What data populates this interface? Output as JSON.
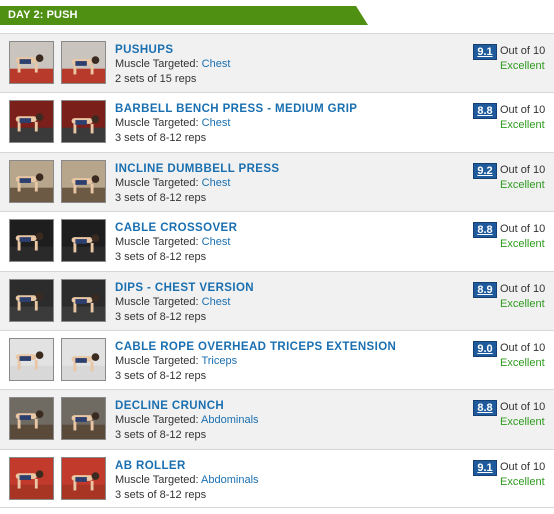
{
  "header": {
    "title": "DAY 2: PUSH",
    "color": "#4f8f12"
  },
  "labels": {
    "muscle_prefix": "Muscle Targeted:",
    "out_of": "Out of 10"
  },
  "exercises": [
    {
      "name": "PUSHUPS",
      "muscle": "Chest",
      "sets": "2 sets of 15 reps",
      "score": "9.1",
      "verdict": "Excellent",
      "thumbs": [
        "pushup-start-image",
        "pushup-end-image"
      ]
    },
    {
      "name": "BARBELL BENCH PRESS - MEDIUM GRIP",
      "muscle": "Chest",
      "sets": "3 sets of 8-12 reps",
      "score": "8.8",
      "verdict": "Excellent",
      "thumbs": [
        "bench-press-start-image",
        "bench-press-end-image"
      ]
    },
    {
      "name": "INCLINE DUMBBELL PRESS",
      "muscle": "Chest",
      "sets": "3 sets of 8-12 reps",
      "score": "9.2",
      "verdict": "Excellent",
      "thumbs": [
        "incline-press-start-image",
        "incline-press-end-image"
      ]
    },
    {
      "name": "CABLE CROSSOVER",
      "muscle": "Chest",
      "sets": "3 sets of 8-12 reps",
      "score": "8.8",
      "verdict": "Excellent",
      "thumbs": [
        "cable-crossover-start-image",
        "cable-crossover-end-image"
      ]
    },
    {
      "name": "DIPS - CHEST VERSION",
      "muscle": "Chest",
      "sets": "3 sets of 8-12 reps",
      "score": "8.9",
      "verdict": "Excellent",
      "thumbs": [
        "dips-start-image",
        "dips-end-image"
      ]
    },
    {
      "name": "CABLE ROPE OVERHEAD TRICEPS EXTENSION",
      "muscle": "Triceps",
      "sets": "3 sets of 8-12 reps",
      "score": "9.0",
      "verdict": "Excellent",
      "thumbs": [
        "triceps-extension-start-image",
        "triceps-extension-end-image"
      ]
    },
    {
      "name": "DECLINE CRUNCH",
      "muscle": "Abdominals",
      "sets": "3 sets of 8-12 reps",
      "score": "8.8",
      "verdict": "Excellent",
      "thumbs": [
        "decline-crunch-start-image",
        "decline-crunch-end-image"
      ]
    },
    {
      "name": "AB ROLLER",
      "muscle": "Abdominals",
      "sets": "3 sets of 8-12 reps",
      "score": "9.1",
      "verdict": "Excellent",
      "thumbs": [
        "ab-roller-start-image",
        "ab-roller-end-image"
      ]
    }
  ]
}
